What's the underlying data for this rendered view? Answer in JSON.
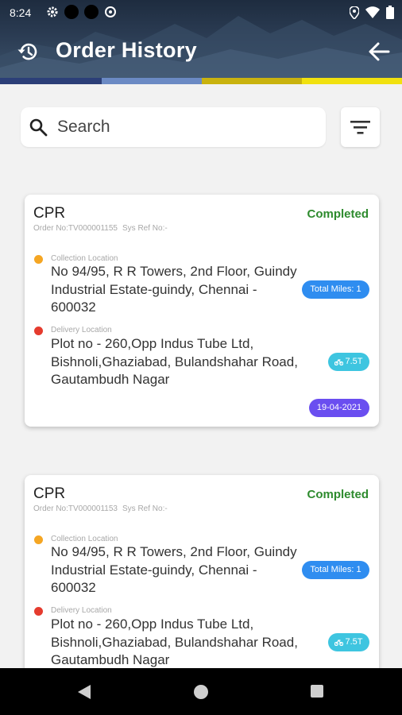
{
  "status_bar": {
    "time": "8:24",
    "icons": [
      "settings-icon",
      "notification-dot",
      "notification-dot",
      "data-saver-icon",
      "location-icon",
      "wifi-icon",
      "battery-icon"
    ]
  },
  "header": {
    "title": "Order History",
    "left_icon": "history-icon",
    "right_icon": "back-arrow-icon",
    "stripe_colors": [
      "#2c3f78",
      "#6b8ac4",
      "#c9b20e",
      "#f1e10f"
    ]
  },
  "search": {
    "placeholder": "Search",
    "value": "",
    "filter_icon": "filter-icon"
  },
  "orders": [
    {
      "company": "CPR",
      "status": "Completed",
      "order_no": "Order No:TV000001155",
      "sys_ref": "Sys Ref No:-",
      "collection_label": "Collection Location",
      "collection_address": "No 94/95, R R Towers, 2nd Floor, Guindy Industrial Estate-guindy, Chennai - 600032",
      "delivery_label": "Delivery Location",
      "delivery_address": "Plot no - 260,Opp Indus Tube Ltd, Bishnoli,Ghaziabad, Bulandshahar Road, Gautambudh Nagar",
      "total_miles": "Total Miles: 1",
      "weight": "7.5T",
      "date": "19-04-2021"
    },
    {
      "company": "CPR",
      "status": "Completed",
      "order_no": "Order No:TV000001153",
      "sys_ref": "Sys Ref No:-",
      "collection_label": "Collection Location",
      "collection_address": "No 94/95, R R Towers, 2nd Floor, Guindy Industrial Estate-guindy, Chennai - 600032",
      "delivery_label": "Delivery Location",
      "delivery_address": "Plot no - 260,Opp Indus Tube Ltd, Bishnoli,Ghaziabad, Bulandshahar Road, Gautambudh Nagar",
      "total_miles": "Total Miles: 1",
      "weight": "7.5T"
    }
  ],
  "colors": {
    "completed": "#2e8b2e",
    "miles_pill": "#2f8df0",
    "weight_pill": "#3ec5e0",
    "date_pill": "#6a4ef0",
    "collection_dot": "#f5a623",
    "delivery_dot": "#e53b2e"
  },
  "nav_bar": {
    "buttons": [
      "back-nav-icon",
      "home-nav-icon",
      "recents-nav-icon"
    ]
  }
}
